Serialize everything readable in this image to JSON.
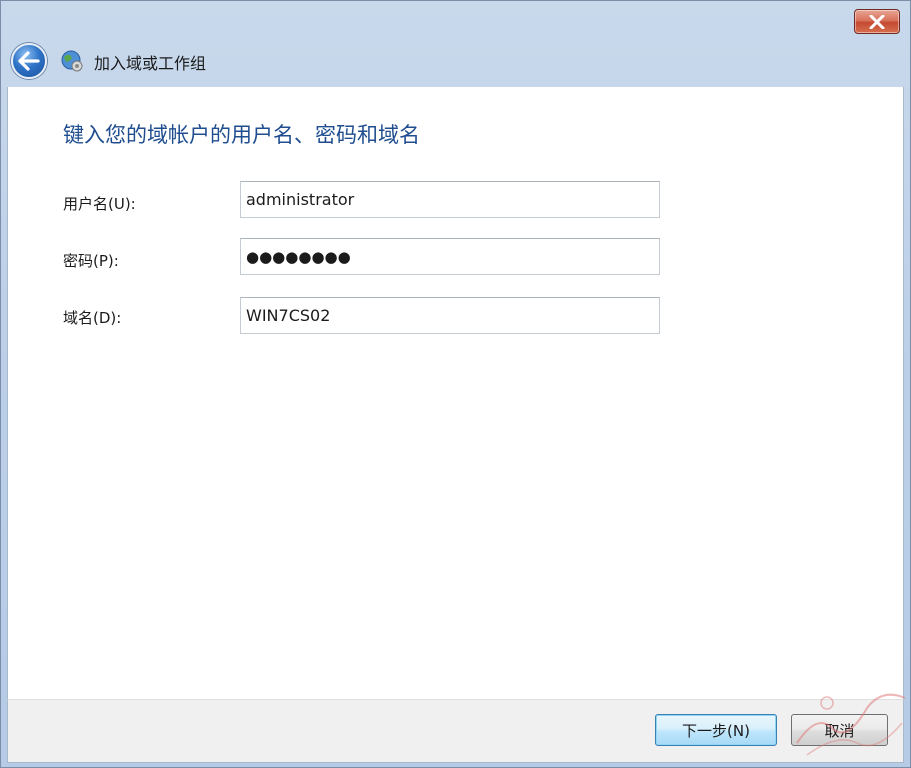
{
  "window": {
    "close_label": "Close"
  },
  "header": {
    "title": "加入域或工作组",
    "back_icon": "back-arrow-icon",
    "network_icon": "network-globe-icon"
  },
  "main": {
    "instruction": "键入您的域帐户的用户名、密码和域名",
    "fields": {
      "username": {
        "label": "用户名(U):",
        "value": "administrator"
      },
      "password": {
        "label": "密码(P):",
        "value": "●●●●●●●●"
      },
      "domain": {
        "label": "域名(D):",
        "value": "WIN7CS02"
      }
    }
  },
  "footer": {
    "next_label": "下一步(N)",
    "cancel_label": "取消"
  },
  "colors": {
    "instruction": "#1f4d8f",
    "close_button": "#c54a32",
    "back_button": "#2f74c8"
  }
}
